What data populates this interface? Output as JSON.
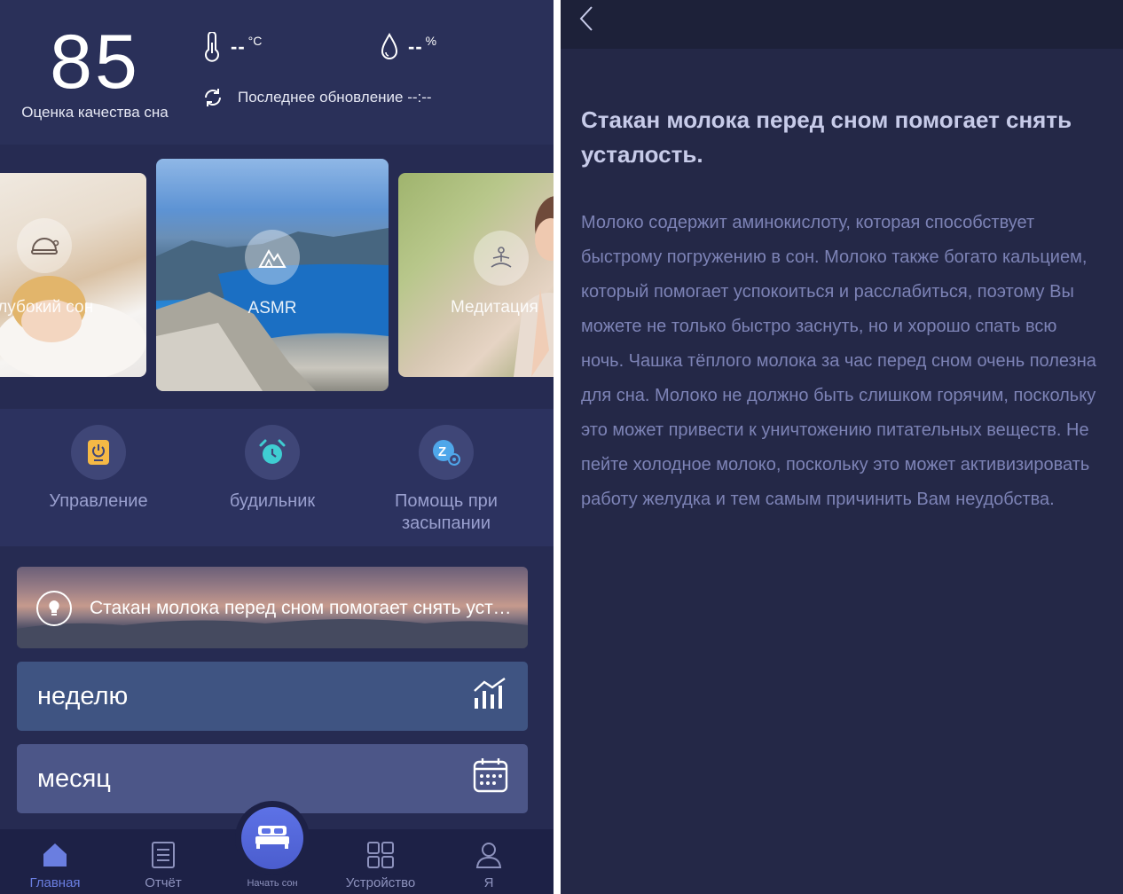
{
  "home": {
    "score": "85",
    "score_label": "Оценка качества сна",
    "temperature": {
      "value": "--",
      "unit": "°C"
    },
    "humidity": {
      "value": "--",
      "unit": "%"
    },
    "last_update": "Последнее обновление --:--",
    "cards": [
      {
        "label": "Глубокий сон",
        "icon": "sleep-cap-icon"
      },
      {
        "label": "ASMR",
        "icon": "mountain-icon"
      },
      {
        "label": "Медитация",
        "icon": "meditation-icon"
      }
    ],
    "menu": [
      {
        "label": "Управление",
        "icon": "power-icon"
      },
      {
        "label": "будильник",
        "icon": "alarm-clock-icon"
      },
      {
        "label": "Помощь при засыпании",
        "icon": "sleep-aid-icon"
      }
    ],
    "tip": "Стакан молока перед сном помогает снять усталость.",
    "week_label": "неделю",
    "month_label": "месяц",
    "nav": {
      "home": "Главная",
      "report": "Отчёт",
      "start": "Начать сон",
      "devices": "Устройство",
      "me": "Я"
    }
  },
  "article": {
    "title": "Стакан молока перед сном помогает снять усталость.",
    "body": "Молоко содержит аминокислоту, которая способствует быстрому погружению в сон. Молоко также богато кальцием, который помогает успокоиться и расслабиться, поэтому Вы можете не только быстро заснуть, но и хорошо спать всю ночь. Чашка тёплого молока за час перед сном очень полезна для сна. Молоко не должно быть слишком горячим, поскольку это может привести к уничтожению питательных веществ. Не пейте холодное молоко, поскольку это может активизировать работу желудка и тем самым причинить Вам неудобства."
  },
  "colors": {
    "accent": "#6a7ee0",
    "background": "#262b52",
    "article_background": "#242847"
  }
}
